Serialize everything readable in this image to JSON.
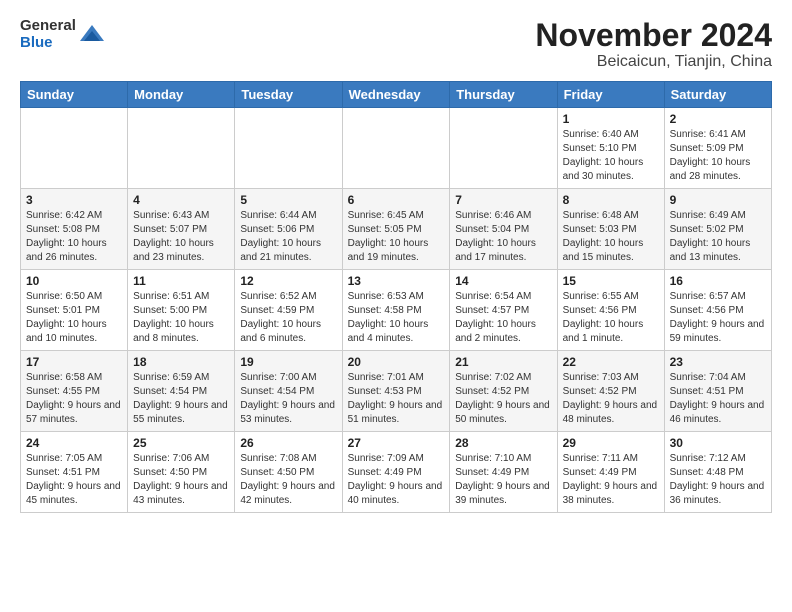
{
  "header": {
    "logo": {
      "line1": "General",
      "line2": "Blue"
    },
    "title": "November 2024",
    "subtitle": "Beicaicun, Tianjin, China"
  },
  "calendar": {
    "weekdays": [
      "Sunday",
      "Monday",
      "Tuesday",
      "Wednesday",
      "Thursday",
      "Friday",
      "Saturday"
    ],
    "weeks": [
      [
        {
          "day": "",
          "info": ""
        },
        {
          "day": "",
          "info": ""
        },
        {
          "day": "",
          "info": ""
        },
        {
          "day": "",
          "info": ""
        },
        {
          "day": "",
          "info": ""
        },
        {
          "day": "1",
          "info": "Sunrise: 6:40 AM\nSunset: 5:10 PM\nDaylight: 10 hours and 30 minutes."
        },
        {
          "day": "2",
          "info": "Sunrise: 6:41 AM\nSunset: 5:09 PM\nDaylight: 10 hours and 28 minutes."
        }
      ],
      [
        {
          "day": "3",
          "info": "Sunrise: 6:42 AM\nSunset: 5:08 PM\nDaylight: 10 hours and 26 minutes."
        },
        {
          "day": "4",
          "info": "Sunrise: 6:43 AM\nSunset: 5:07 PM\nDaylight: 10 hours and 23 minutes."
        },
        {
          "day": "5",
          "info": "Sunrise: 6:44 AM\nSunset: 5:06 PM\nDaylight: 10 hours and 21 minutes."
        },
        {
          "day": "6",
          "info": "Sunrise: 6:45 AM\nSunset: 5:05 PM\nDaylight: 10 hours and 19 minutes."
        },
        {
          "day": "7",
          "info": "Sunrise: 6:46 AM\nSunset: 5:04 PM\nDaylight: 10 hours and 17 minutes."
        },
        {
          "day": "8",
          "info": "Sunrise: 6:48 AM\nSunset: 5:03 PM\nDaylight: 10 hours and 15 minutes."
        },
        {
          "day": "9",
          "info": "Sunrise: 6:49 AM\nSunset: 5:02 PM\nDaylight: 10 hours and 13 minutes."
        }
      ],
      [
        {
          "day": "10",
          "info": "Sunrise: 6:50 AM\nSunset: 5:01 PM\nDaylight: 10 hours and 10 minutes."
        },
        {
          "day": "11",
          "info": "Sunrise: 6:51 AM\nSunset: 5:00 PM\nDaylight: 10 hours and 8 minutes."
        },
        {
          "day": "12",
          "info": "Sunrise: 6:52 AM\nSunset: 4:59 PM\nDaylight: 10 hours and 6 minutes."
        },
        {
          "day": "13",
          "info": "Sunrise: 6:53 AM\nSunset: 4:58 PM\nDaylight: 10 hours and 4 minutes."
        },
        {
          "day": "14",
          "info": "Sunrise: 6:54 AM\nSunset: 4:57 PM\nDaylight: 10 hours and 2 minutes."
        },
        {
          "day": "15",
          "info": "Sunrise: 6:55 AM\nSunset: 4:56 PM\nDaylight: 10 hours and 1 minute."
        },
        {
          "day": "16",
          "info": "Sunrise: 6:57 AM\nSunset: 4:56 PM\nDaylight: 9 hours and 59 minutes."
        }
      ],
      [
        {
          "day": "17",
          "info": "Sunrise: 6:58 AM\nSunset: 4:55 PM\nDaylight: 9 hours and 57 minutes."
        },
        {
          "day": "18",
          "info": "Sunrise: 6:59 AM\nSunset: 4:54 PM\nDaylight: 9 hours and 55 minutes."
        },
        {
          "day": "19",
          "info": "Sunrise: 7:00 AM\nSunset: 4:54 PM\nDaylight: 9 hours and 53 minutes."
        },
        {
          "day": "20",
          "info": "Sunrise: 7:01 AM\nSunset: 4:53 PM\nDaylight: 9 hours and 51 minutes."
        },
        {
          "day": "21",
          "info": "Sunrise: 7:02 AM\nSunset: 4:52 PM\nDaylight: 9 hours and 50 minutes."
        },
        {
          "day": "22",
          "info": "Sunrise: 7:03 AM\nSunset: 4:52 PM\nDaylight: 9 hours and 48 minutes."
        },
        {
          "day": "23",
          "info": "Sunrise: 7:04 AM\nSunset: 4:51 PM\nDaylight: 9 hours and 46 minutes."
        }
      ],
      [
        {
          "day": "24",
          "info": "Sunrise: 7:05 AM\nSunset: 4:51 PM\nDaylight: 9 hours and 45 minutes."
        },
        {
          "day": "25",
          "info": "Sunrise: 7:06 AM\nSunset: 4:50 PM\nDaylight: 9 hours and 43 minutes."
        },
        {
          "day": "26",
          "info": "Sunrise: 7:08 AM\nSunset: 4:50 PM\nDaylight: 9 hours and 42 minutes."
        },
        {
          "day": "27",
          "info": "Sunrise: 7:09 AM\nSunset: 4:49 PM\nDaylight: 9 hours and 40 minutes."
        },
        {
          "day": "28",
          "info": "Sunrise: 7:10 AM\nSunset: 4:49 PM\nDaylight: 9 hours and 39 minutes."
        },
        {
          "day": "29",
          "info": "Sunrise: 7:11 AM\nSunset: 4:49 PM\nDaylight: 9 hours and 38 minutes."
        },
        {
          "day": "30",
          "info": "Sunrise: 7:12 AM\nSunset: 4:48 PM\nDaylight: 9 hours and 36 minutes."
        }
      ]
    ]
  }
}
